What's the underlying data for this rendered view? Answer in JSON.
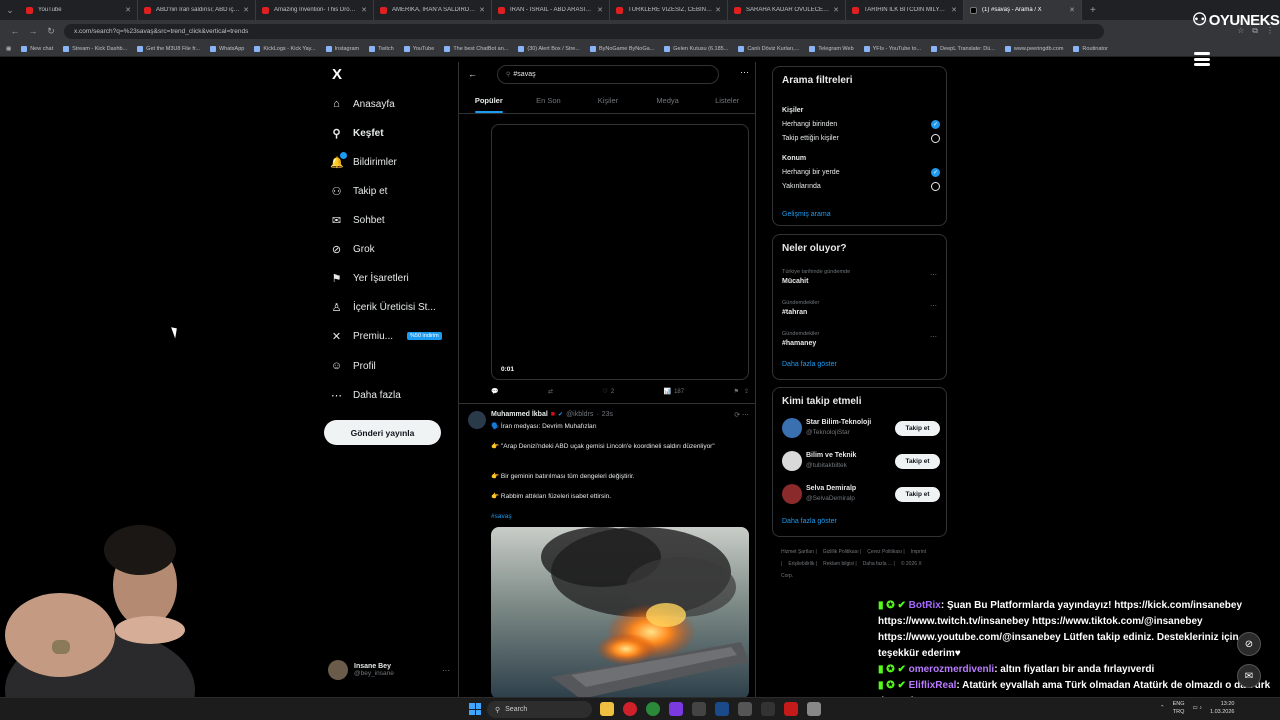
{
  "browser": {
    "tabs": [
      {
        "title": "YouTube"
      },
      {
        "title": "ABD'nin İran saldırısı; ABD için..."
      },
      {
        "title": "Amazing Invention- This Drone..."
      },
      {
        "title": "AMERİKA, İRAN'A SALDIRDI | ..."
      },
      {
        "title": "İRAN - İSRAİL - ABD ARASINDA..."
      },
      {
        "title": "TÜRKLERE VİZESİZ, CEBİNİZİ W..."
      },
      {
        "title": "SARAHA KADAR ÖVÜLECEK ON..."
      },
      {
        "title": "TARİHİN İLK BİTCOİN MİLYARD..."
      },
      {
        "title": "(1) #savaş - Arama / X",
        "active": true
      }
    ],
    "url": "x.com/search?q=%23savaş&src=trend_click&vertical=trends",
    "bookmarks": [
      "New chat",
      "Stream - Kick Dashb...",
      "Get the M3U8 File fr...",
      "WhatsApp",
      "KickLogs - Kick Yay...",
      "Instagram",
      "Twitch",
      "YouTube",
      "The best ChatBot an...",
      "(30) Alert Box / Stre...",
      "ByNoGame ByNoGa...",
      "Gelen Kutusu (6.185...",
      "Canlı Döviz Kurları,...",
      "Telegram Web",
      "YFIs - YouTube to...",
      "DeepL Translate: Dü...",
      "www.peeringdb.com",
      "Routinator"
    ]
  },
  "sidebar": {
    "logo": "X",
    "items": [
      {
        "label": "Anasayfa",
        "icon": "home-icon",
        "glyph": "⌂"
      },
      {
        "label": "Keşfet",
        "icon": "search-icon",
        "glyph": "⚲",
        "active": true
      },
      {
        "label": "Bildirimler",
        "icon": "bell-icon",
        "glyph": "🔔"
      },
      {
        "label": "Takip et",
        "icon": "add-person-icon",
        "glyph": "⚇"
      },
      {
        "label": "Sohbet",
        "icon": "mail-icon",
        "glyph": "✉"
      },
      {
        "label": "Grok",
        "icon": "grok-icon",
        "glyph": "⊘"
      },
      {
        "label": "Yer İşaretleri",
        "icon": "bookmark-icon",
        "glyph": "⚑"
      },
      {
        "label": "İçerik Üreticisi St...",
        "icon": "creator-icon",
        "glyph": "♙"
      },
      {
        "label": "Premiu...",
        "icon": "x-premium-icon",
        "glyph": "✕",
        "promo": "%50 indirim"
      },
      {
        "label": "Profil",
        "icon": "profile-icon",
        "glyph": "☺"
      },
      {
        "label": "Daha fazla",
        "icon": "more-icon",
        "glyph": "⋯"
      }
    ],
    "post_button": "Gönderi yayınla",
    "profile": {
      "name": "Insane Bey",
      "handle": "@bey_insane"
    }
  },
  "main": {
    "search_value": "#savaş",
    "tabs": [
      "Popüler",
      "En Son",
      "Kişiler",
      "Medya",
      "Listeler"
    ],
    "video": {
      "time": "0:01"
    },
    "video_actions": {
      "likes": "2",
      "views": "187"
    },
    "tweet": {
      "name": "Muhammed İkbal",
      "handle": "@ikbldrs",
      "time": "23s",
      "lines": [
        "🗣️ İran medyası: Devrim Muhafızları",
        "👉 \"Arap Denizi'ndeki ABD uçak gemisi Lincoln'e koordineli saldırı düzenliyor\"",
        "👉 Bir geminin batırılması tüm dengeleri değiştirir.",
        "👉 Rabbim attıkları füzeleri isabet ettirsin."
      ],
      "hashtag": "#savaş"
    }
  },
  "right": {
    "filters": {
      "title": "Arama filtreleri",
      "people_title": "Kişiler",
      "people_opts": [
        "Herhangi birinden",
        "Takip ettiğin kişiler"
      ],
      "location_title": "Konum",
      "location_opts": [
        "Herhangi bir yerde",
        "Yakınlarında"
      ],
      "advanced": "Gelişmiş arama"
    },
    "trends": {
      "title": "Neler oluyor?",
      "items": [
        {
          "context": "Türkiye tarihinde gündemde",
          "name": "Mücahit"
        },
        {
          "context": "Gündemdekiler",
          "name": "#tahran"
        },
        {
          "context": "Gündemdekiler",
          "name": "#hamaney"
        }
      ],
      "more": "Daha fazla göster"
    },
    "who_to_follow": {
      "title": "Kimi takip etmeli",
      "items": [
        {
          "name": "Star Bilim-Teknoloji",
          "handle": "@TeknolojiStar",
          "color": "#3a6fb0"
        },
        {
          "name": "Bilim ve Teknik",
          "handle": "@tubitakbiltek",
          "color": "#d9d9d9"
        },
        {
          "name": "Selva Demiralp",
          "handle": "@SelvaDemiralp",
          "color": "#8a2a2a"
        }
      ],
      "follow_label": "Takip et",
      "more": "Daha fazla göster"
    },
    "footer": [
      "Hizmet Şartları",
      "Gizlilik Politikası",
      "Çerez Politikası",
      "Imprint",
      "Erişilebilirlik",
      "Reklam bilgisi",
      "Daha fazla ...",
      "© 2026 X Corp."
    ]
  },
  "overlay": {
    "brand": "OYUNEKS",
    "chat": [
      {
        "user": "BotRix",
        "text": ": Şuan Bu Platformlarda yayındayız! https://kick.com/insanebey https://www.twitch.tv/insanebey https://www.tiktok.com/@insanebey https://www.youtube.com/@insanebey Lütfen takip ediniz. Destekleriniz için teşekkür ederim♥"
      },
      {
        "user": "omerozmerdivenli",
        "text": ": altın fiyatları bir anda fırlayıverdi"
      },
      {
        "user": "EliflixReal",
        "text": ": Atatürk eyvallah ama Türk olmadan Atatürk de olmazdı o da Türk dü çünkü"
      }
    ]
  },
  "taskbar": {
    "search": "Search",
    "lang": "ENG\nTRQ",
    "time": "13:20",
    "date": "1.03.2026"
  }
}
